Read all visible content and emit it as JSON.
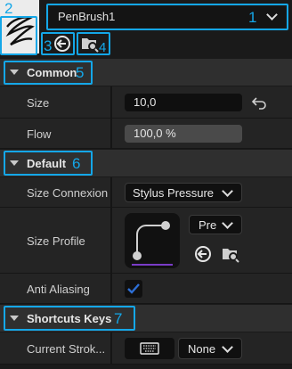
{
  "brush": {
    "name": "PenBrush1"
  },
  "callouts": [
    "1",
    "2",
    "3",
    "4",
    "5",
    "6",
    "7"
  ],
  "sections": {
    "common": {
      "title": "Common"
    },
    "default": {
      "title": "Default"
    },
    "shortcuts": {
      "title": "Shortcuts Keys"
    }
  },
  "common": {
    "size_label": "Size",
    "size_value": "10,0",
    "flow_label": "Flow",
    "flow_value": "100,0 %",
    "flow_fraction": 1.0
  },
  "default": {
    "size_connexion_label": "Size Connexion",
    "size_connexion_value": "Stylus Pressure",
    "size_profile_label": "Size Profile",
    "size_profile_dropdown": "Pre",
    "anti_aliasing_label": "Anti Aliasing",
    "anti_aliasing_checked": true
  },
  "shortcuts": {
    "current_stroke_label": "Current Strok...",
    "current_stroke_value": "None"
  },
  "colors": {
    "accent": "#14a7e8",
    "check": "#2d6fd6",
    "background": "#1a1a1a",
    "curve": "#7a3cc8"
  },
  "icons": [
    "brush-thumbnail-icon",
    "back-arrow-icon",
    "browse-folder-icon",
    "reset-arrow-icon",
    "chevron-down-icon",
    "expand-triangle-icon",
    "keyboard-icon",
    "checkmark-icon",
    "curve-icon"
  ]
}
